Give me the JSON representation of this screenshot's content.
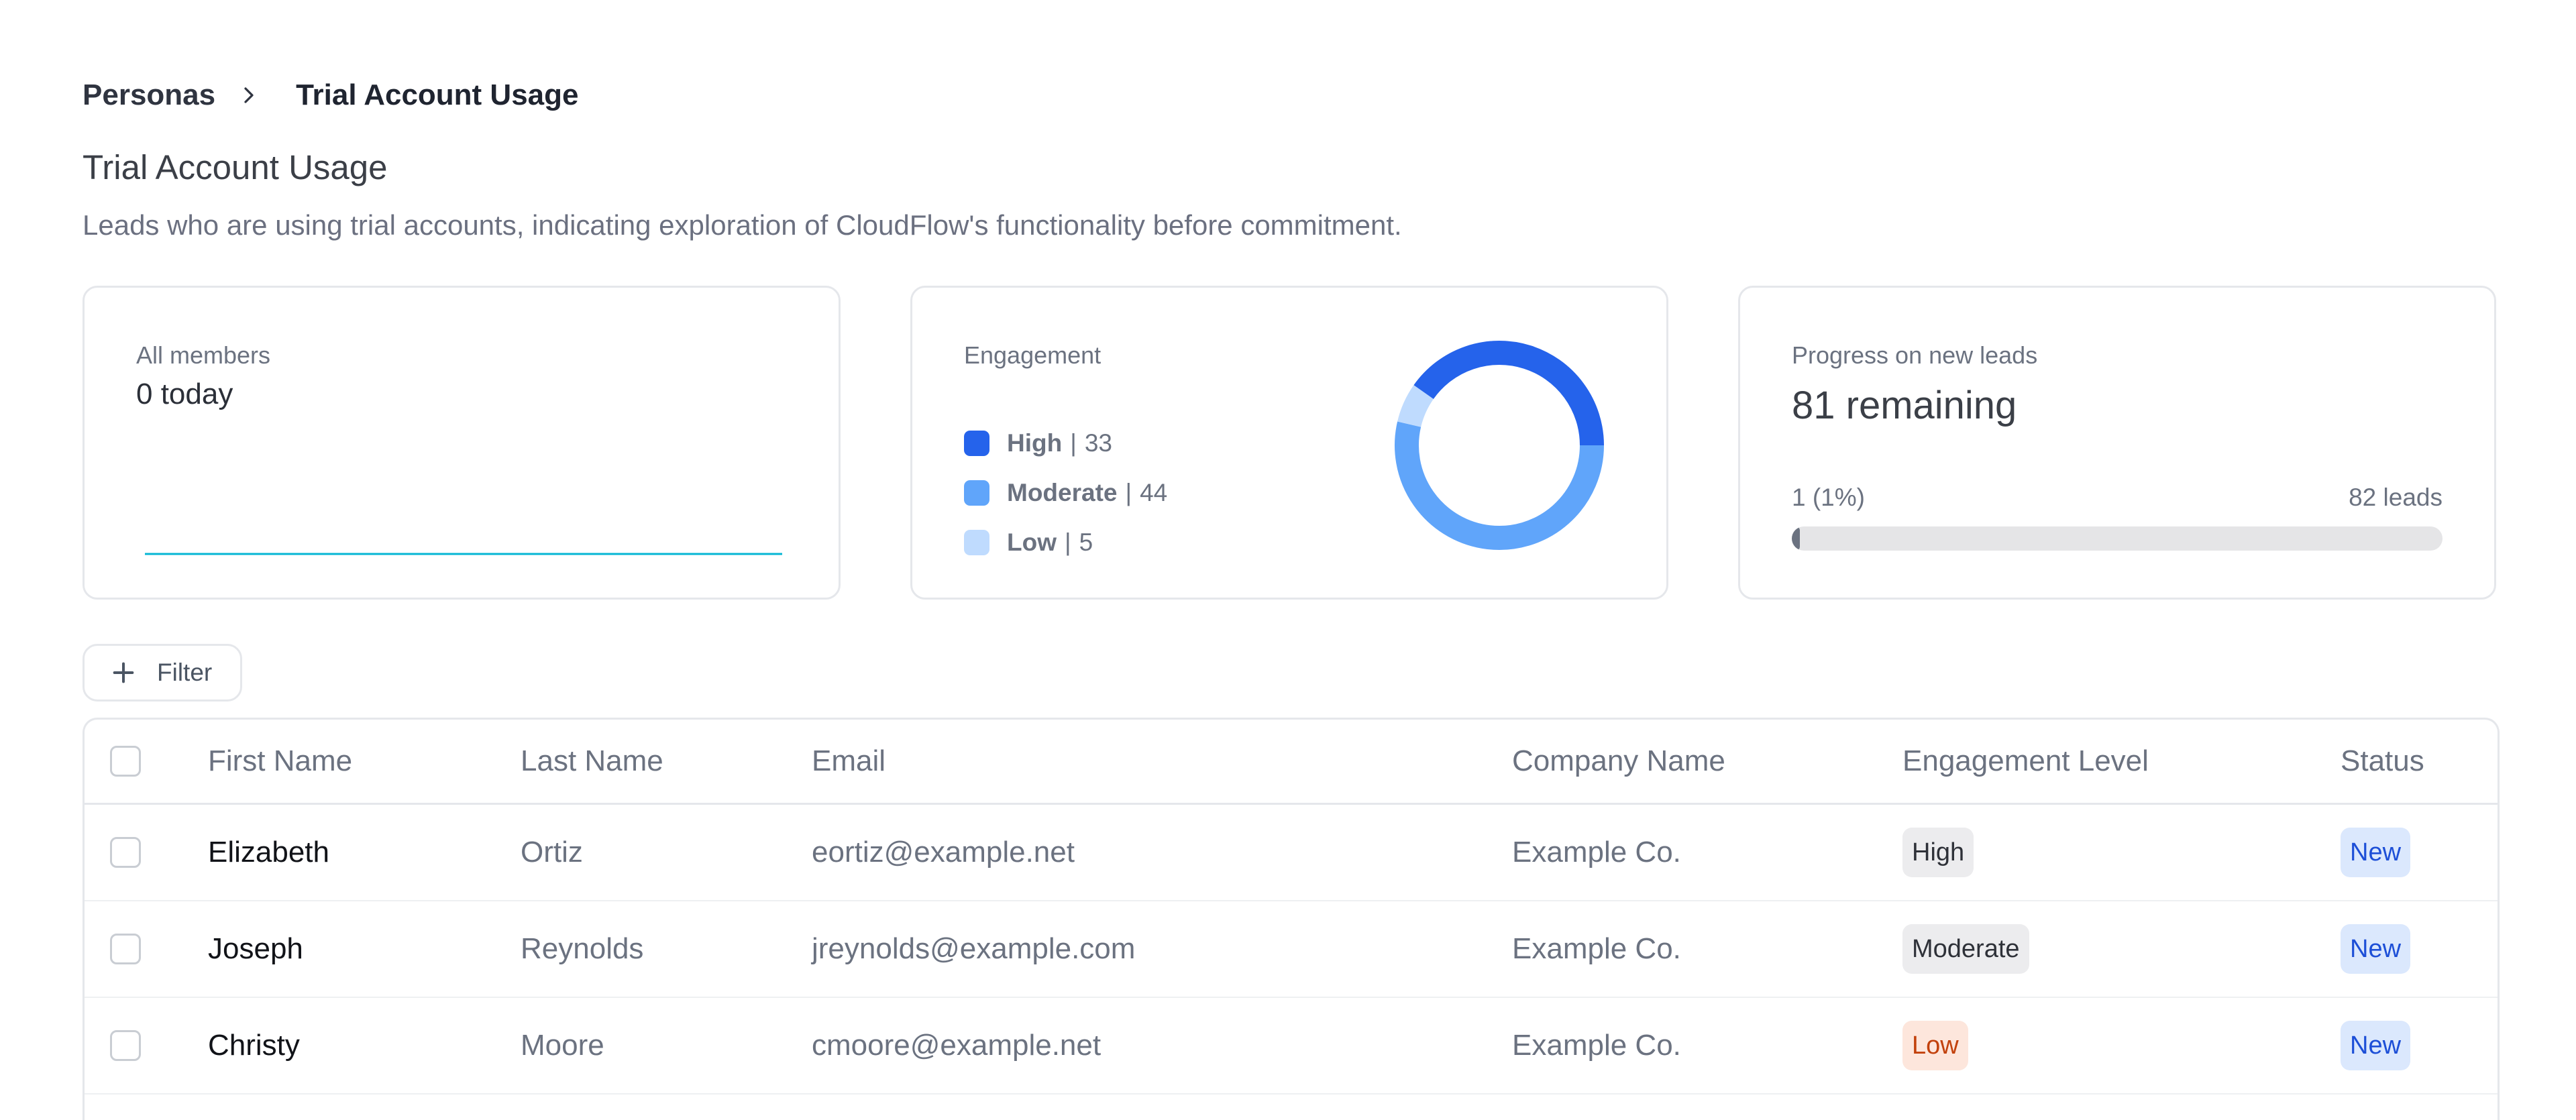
{
  "breadcrumb": {
    "root": "Personas",
    "current": "Trial Account Usage"
  },
  "page": {
    "title": "Trial Account Usage",
    "description": "Leads who are using trial accounts, indicating exploration of CloudFlow's functionality before commitment."
  },
  "cards": {
    "members": {
      "label": "All members",
      "value": "0 today"
    },
    "engagement": {
      "label": "Engagement",
      "legend": [
        {
          "name": "High",
          "value": "33",
          "color": "#2563eb"
        },
        {
          "name": "Moderate",
          "value": "44",
          "color": "#60a5fa"
        },
        {
          "name": "Low",
          "value": "5",
          "color": "#bfdbfe"
        }
      ]
    },
    "progress": {
      "label": "Progress on new leads",
      "value": "81 remaining",
      "left_note": "1 (1%)",
      "right_note": "82 leads",
      "fraction": 0.0122
    }
  },
  "chart_data": [
    {
      "type": "line",
      "title": "",
      "values": [
        0,
        0,
        0,
        0,
        0,
        0,
        0
      ],
      "color": "#06b6d4"
    },
    {
      "type": "pie",
      "title": "",
      "labels": [
        "High",
        "Moderate",
        "Low"
      ],
      "values": [
        33,
        44,
        5
      ],
      "colors": [
        "#2563eb",
        "#60a5fa",
        "#bfdbfe"
      ]
    }
  ],
  "filter": {
    "label": "Filter"
  },
  "table": {
    "columns": [
      "First Name",
      "Last Name",
      "Email",
      "Company Name",
      "Engagement Level",
      "Status"
    ],
    "rows": [
      {
        "first": "Elizabeth",
        "last": "Ortiz",
        "email": "eortiz@example.net",
        "company": "Example Co.",
        "engagement": "High",
        "status": "New"
      },
      {
        "first": "Joseph",
        "last": "Reynolds",
        "email": "jreynolds@example.com",
        "company": "Example Co.",
        "engagement": "Moderate",
        "status": "New"
      },
      {
        "first": "Christy",
        "last": "Moore",
        "email": "cmoore@example.net",
        "company": "Example Co.",
        "engagement": "Low",
        "status": "New"
      }
    ]
  },
  "colors": {
    "accent": "#2563eb",
    "line": "#06b6d4",
    "low_badge_text": "#c2410c",
    "status_badge_text": "#1d4fd7"
  }
}
